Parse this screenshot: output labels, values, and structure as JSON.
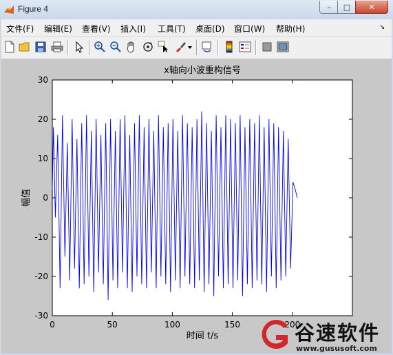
{
  "window": {
    "title": "Figure 4",
    "minimize_glyph": "–",
    "maximize_glyph": "□",
    "close_glyph": "✕"
  },
  "menu": {
    "items": [
      "文件(F)",
      "编辑(E)",
      "查看(V)",
      "插入(I)",
      "工具(T)",
      "桌面(D)",
      "窗口(W)",
      "帮助(H)"
    ],
    "overflow_glyph": "↘"
  },
  "toolbar": {
    "icons": [
      "new-figure-icon",
      "open-file-icon",
      "save-icon",
      "print-icon",
      "pointer-icon",
      "zoom-in-icon",
      "zoom-out-icon",
      "pan-hand-icon",
      "rotate-3d-icon",
      "data-cursor-icon",
      "brush-icon",
      "brush-dropdown-icon",
      "link-plot-icon",
      "colorbar-icon",
      "legend-icon",
      "hide-plot-tools-icon",
      "show-plot-tools-icon"
    ]
  },
  "chart_data": {
    "type": "line",
    "title": "x轴向小波重构信号",
    "xlabel": "时间 t/s",
    "ylabel": "幅值",
    "xlim": [
      0,
      250
    ],
    "ylim": [
      -30,
      30
    ],
    "xticks": [
      "0",
      "50",
      "100",
      "150",
      "200"
    ],
    "yticks": [
      "30",
      "20",
      "10",
      "0",
      "-10",
      "-20",
      "-30"
    ],
    "grid": false,
    "series": [
      {
        "color": "#0000ff",
        "x": [
          0,
          1,
          2.5,
          4.5,
          6.5,
          8.5,
          10.5,
          12.5,
          14.5,
          16.5,
          18.5,
          20.5,
          22.5,
          24.5,
          26.5,
          28.5,
          30.5,
          32.5,
          34.5,
          36.5,
          38.5,
          40.5,
          42.5,
          44.5,
          46.5,
          48.5,
          50.5,
          52.5,
          54.5,
          56.5,
          58.5,
          60.5,
          62.5,
          64.5,
          66.5,
          68.5,
          70.5,
          72.5,
          74.5,
          76.5,
          78.5,
          80.5,
          82.5,
          84.5,
          86.5,
          88.5,
          90.5,
          92.5,
          94.5,
          96.5,
          98.5,
          100.5,
          102.5,
          104.5,
          106.5,
          108.5,
          110.5,
          112.5,
          114.5,
          116.5,
          118.5,
          120.5,
          122.5,
          124.5,
          126.5,
          128.5,
          130.5,
          132.5,
          134.5,
          136.5,
          138.5,
          140.5,
          142.5,
          144.5,
          146.5,
          148.5,
          150.5,
          152.5,
          154.5,
          156.5,
          158.5,
          160.5,
          162.5,
          164.5,
          166.5,
          168.5,
          170.5,
          172.5,
          174.5,
          176.5,
          178.5,
          180.5,
          182.5,
          184.5,
          186.5,
          188.5,
          190.5,
          192.5,
          194.5,
          196.5,
          198.5,
          200.5,
          202.5,
          204
        ],
        "y": [
          2,
          18,
          -5,
          16,
          -23,
          21,
          -15,
          14,
          -21,
          20,
          -18,
          15,
          -23,
          19,
          -22,
          21,
          -20,
          17,
          -24,
          20,
          -19,
          16,
          -22,
          19,
          -26,
          20,
          -21,
          17,
          -23,
          20,
          -19,
          21,
          -23,
          16,
          -24,
          19,
          -20,
          21,
          -22,
          18,
          -23,
          20,
          -19,
          17,
          -23,
          21,
          -20,
          18,
          -22,
          19,
          -24,
          20,
          -21,
          17,
          -23,
          21,
          -20,
          19,
          -22,
          18,
          -23,
          20,
          -21,
          22,
          -24,
          19,
          -22,
          17,
          -25,
          21,
          -20,
          18,
          -23,
          21,
          -22,
          20,
          -23,
          19,
          -21,
          21,
          -25,
          18,
          -22,
          20,
          -23,
          19,
          -21,
          21,
          -22,
          18,
          -24,
          20,
          -20,
          19,
          -23,
          18,
          -21,
          17,
          -20,
          15,
          -18,
          4,
          2,
          0
        ]
      }
    ]
  },
  "watermark": {
    "name": "谷速软件",
    "url": "www.gususoft.com"
  }
}
